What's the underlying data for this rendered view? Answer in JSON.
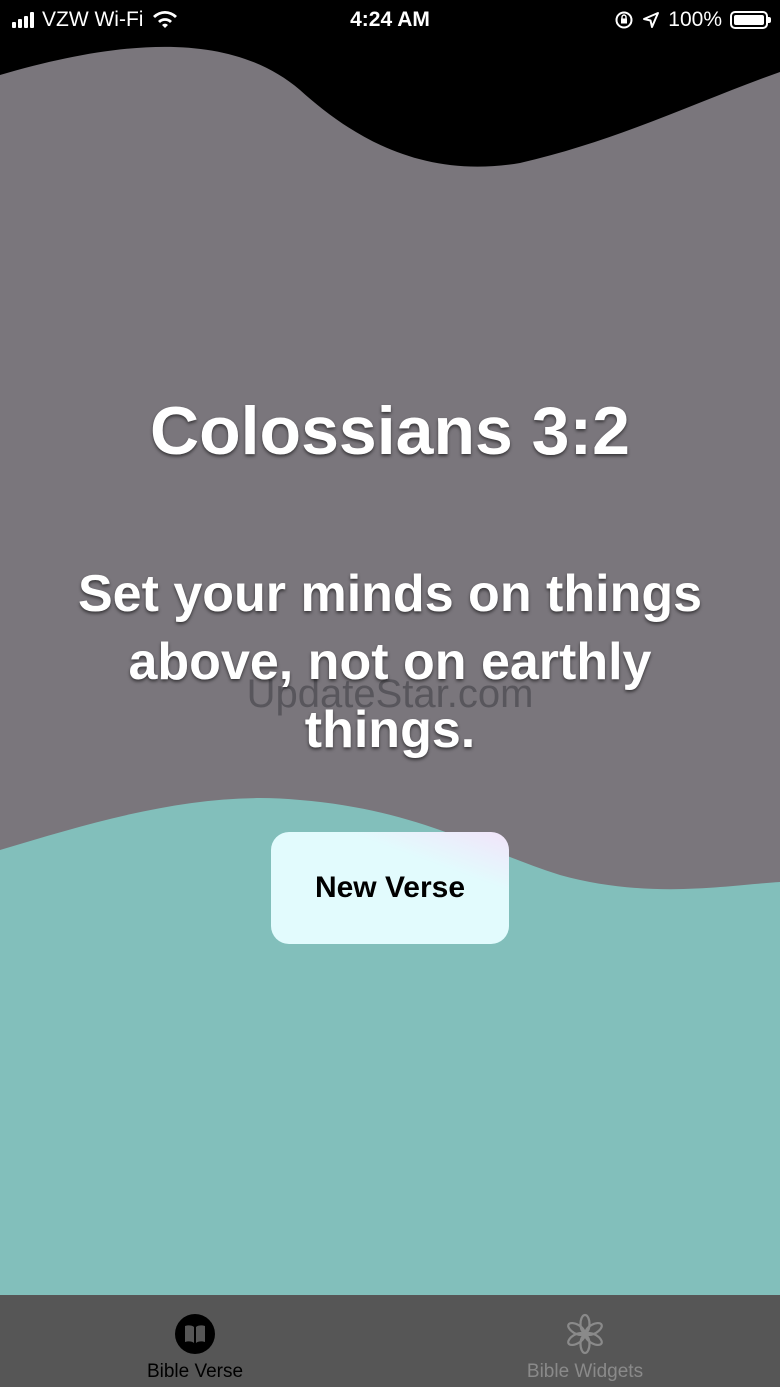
{
  "status_bar": {
    "carrier": "VZW Wi-Fi",
    "time": "4:24 AM",
    "battery": "100%",
    "icons": [
      "signal-icon",
      "wifi-icon",
      "orientation-lock-icon",
      "location-icon",
      "battery-icon"
    ]
  },
  "verse": {
    "reference": "Colossians 3:2",
    "text": "Set your minds on things above, not on earthly things."
  },
  "watermark": "UpdateStar.com",
  "new_verse_button": {
    "label": "New Verse"
  },
  "tabs": [
    {
      "label": "Bible Verse",
      "icon": "book-icon",
      "active": true
    },
    {
      "label": "Bible Widgets",
      "icon": "widgets-icon",
      "active": false
    }
  ],
  "colors": {
    "top_wave": "#000000",
    "middle_background": "#7a767c",
    "bottom_wave": "#82bfbb",
    "tab_bar": "#565656",
    "button_background": "#e2fbfd"
  }
}
